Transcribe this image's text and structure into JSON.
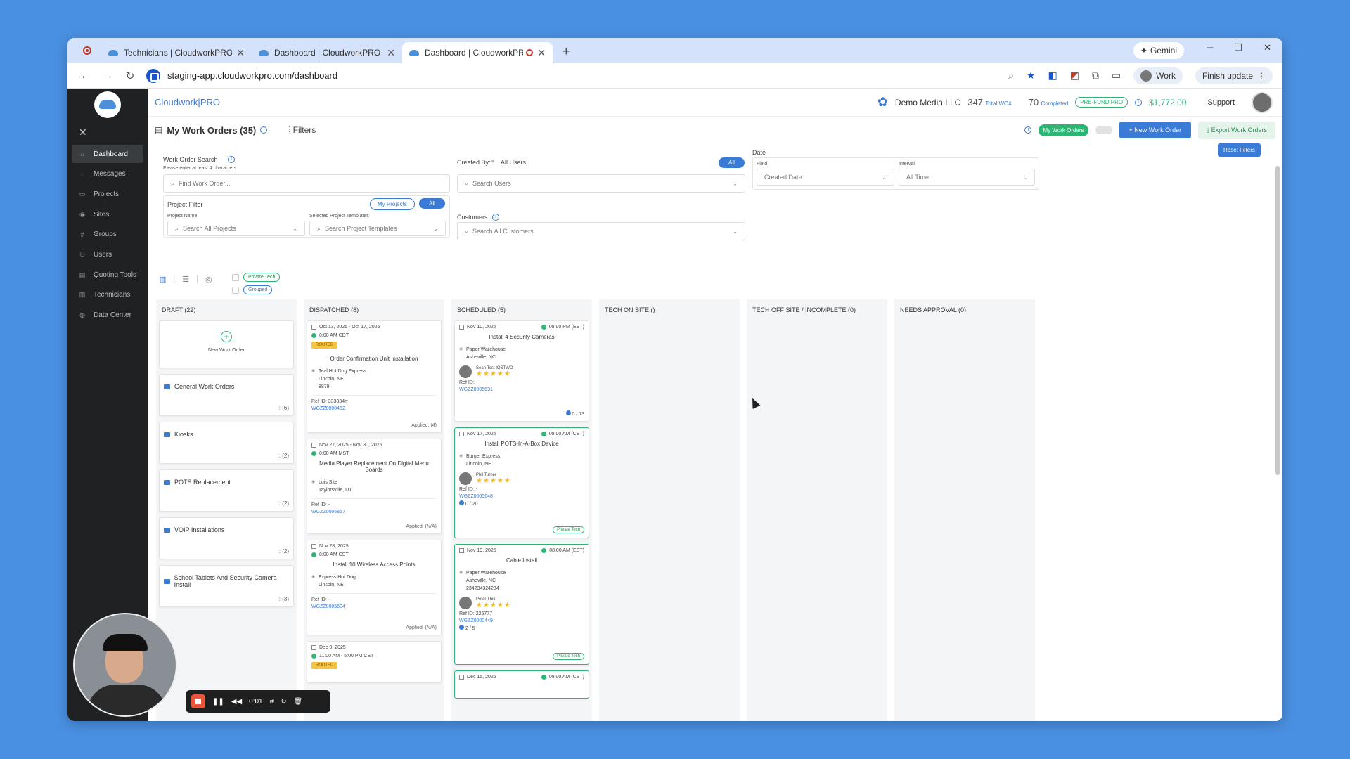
{
  "browser": {
    "tabs": [
      {
        "title": "Technicians | CloudworkPRO",
        "active": false
      },
      {
        "title": "Dashboard | CloudworkPRO",
        "active": false
      },
      {
        "title": "Dashboard | CloudworkPRO",
        "active": true
      }
    ],
    "gemini_label": "Gemini",
    "url": "staging-app.cloudworkpro.com/dashboard",
    "profile_label": "Work",
    "update_label": "Finish update"
  },
  "sidebar": {
    "items": [
      {
        "label": "Dashboard",
        "active": true
      },
      {
        "label": "Messages"
      },
      {
        "label": "Projects"
      },
      {
        "label": "Sites"
      },
      {
        "label": "Groups"
      },
      {
        "label": "Users"
      },
      {
        "label": "Quoting Tools"
      },
      {
        "label": "Technicians"
      },
      {
        "label": "Data Center"
      }
    ]
  },
  "header": {
    "brand_a": "Cloudwork",
    "brand_b": "PRO",
    "org": "Demo Media LLC",
    "total_wo": "347",
    "total_wo_label": "Total WO#",
    "completed": "70",
    "completed_label": "Completed",
    "prefund": "PRE-FUND PRO",
    "balance": "$1,772.00",
    "support": "Support"
  },
  "toolbar": {
    "title": "My Work Orders (35)",
    "filters": "Filters",
    "my_work_orders": "My Work Orders",
    "new_wo": "+ New Work Order",
    "export": "Export Work Orders",
    "reset": "Reset Filters"
  },
  "filters": {
    "wo_search_label": "Work Order Search",
    "wo_search_hint": "Please enter at least 4 characters",
    "wo_search_placeholder": "Find Work Order...",
    "created_by_label": "Created By:",
    "created_by_value": "All Users",
    "all_pill": "All",
    "search_users": "Search Users",
    "date_label": "Date",
    "field_label": "Field",
    "field_value": "Created Date",
    "interval_label": "Interval",
    "interval_value": "All Time",
    "project_filter_label": "Project Filter",
    "my_projects": "My Projects",
    "all_projects_pill": "All",
    "project_name_label": "Project Name",
    "project_name_placeholder": "Search All Projects",
    "templates_label": "Selected Project Templates",
    "templates_placeholder": "Search Project Templates",
    "customers_label": "Customers",
    "customers_placeholder": "Search All Customers",
    "private_tech": "Private Tech",
    "grouped": "Grouped"
  },
  "board": {
    "draft": {
      "title": "DRAFT (22)",
      "new_wo": "New Work Order",
      "groups": [
        {
          "name": "General Work Orders",
          "count": ": (6)"
        },
        {
          "name": "Kiosks",
          "count": ": (2)"
        },
        {
          "name": "POTS Replacement",
          "count": ": (2)"
        },
        {
          "name": "VOIP Installations",
          "count": ": (2)"
        },
        {
          "name": "School Tablets And Security Camera Install",
          "count": ": (3)"
        }
      ]
    },
    "dispatched": {
      "title": "DISPATCHED (8)",
      "cards": [
        {
          "date": "Oct 13, 2025 - Oct 17, 2025",
          "time": "8:00 AM CDT",
          "tag": "ROUTED",
          "title": "Order Confirmation Unit Installation",
          "site": "Teal Hot Dog Express",
          "city": "Lincoln, NE",
          "extra": "8879",
          "ref": "Ref ID: 333334rr",
          "wo": "WGZZ0000452",
          "applied": "Applied: (4)"
        },
        {
          "date": "Nov 27, 2025 - Nov 30, 2025",
          "time": "8:00 AM MST",
          "tag": "",
          "title": "Media Player Replacement On Digital Menu Boards",
          "site": "Luis Site",
          "city": "Taylorsville, UT",
          "extra": "",
          "ref": "Ref ID: -",
          "wo": "WGZZ0005857",
          "applied": "Applied: (N/A)"
        },
        {
          "date": "Nov 28, 2025",
          "time": "8:00 AM CST",
          "tag": "",
          "title": "Install 10 Wireless Access Points",
          "site": "Express Hot Dog",
          "city": "Lincoln, NE",
          "extra": "",
          "ref": "Ref ID: -",
          "wo": "WGZZ0005634",
          "applied": "Applied: (N/A)"
        },
        {
          "date": "Dec 9, 2025",
          "time": "11:00 AM - 5:00 PM CST",
          "tag": "ROUTED",
          "title": "",
          "site": "",
          "city": "",
          "extra": "",
          "ref": "",
          "wo": "",
          "applied": ""
        }
      ]
    },
    "scheduled": {
      "title": "SCHEDULED (5)",
      "cards": [
        {
          "date": "Nov 10, 2025",
          "time": "08:00 PM (EST)",
          "title": "Install 4 Security Cameras",
          "site": "Paper Warehouse",
          "city": "Asheville, NC",
          "extra": "",
          "tech": "Sean Test IOSTWO",
          "ref": "Ref ID: -",
          "wo": "WGZZ0005631",
          "progress": "0 / 13",
          "tag": ""
        },
        {
          "date": "Nov 17, 2025",
          "time": "08:00 AM (CST)",
          "title": "Install POTS-In-A-Box Device",
          "site": "Burger Express",
          "city": "Lincoln, NE",
          "extra": "",
          "tech": "Phil Turner",
          "ref": "Ref ID: -",
          "wo": "WGZZ0005648",
          "progress": "0 / 20",
          "tag": "Private Tech"
        },
        {
          "date": "Nov 19, 2025",
          "time": "08:00 AM (EST)",
          "title": "Cable Install",
          "site": "Paper Warehouse",
          "city": "Asheville, NC",
          "extra": "234234324234",
          "tech": "Peter Thiel",
          "ref": "Ref ID: 225777",
          "wo": "WGZZ0000449",
          "progress": "2 / 5",
          "tag": "Private Tech"
        },
        {
          "date": "Dec 15, 2025",
          "time": "08:00 AM (CST)",
          "title": "",
          "site": "",
          "city": "",
          "extra": "",
          "tech": "",
          "ref": "",
          "wo": "",
          "progress": "",
          "tag": ""
        }
      ]
    },
    "onsite": {
      "title": "TECH ON SITE ()"
    },
    "offsite": {
      "title": "TECH OFF SITE / INCOMPLETE (0)"
    },
    "approval": {
      "title": "NEEDS APPROVAL (0)"
    }
  },
  "recorder": {
    "time": "0:01"
  }
}
